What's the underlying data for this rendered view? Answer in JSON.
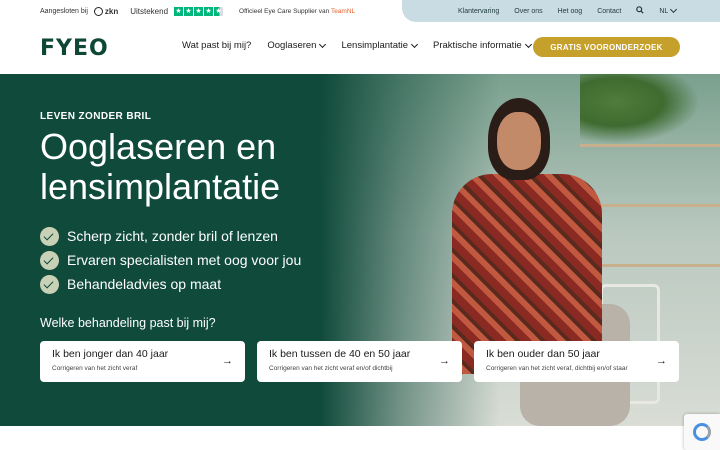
{
  "topbar": {
    "affiliated": "Aangesloten bij",
    "zkn": "zkn",
    "rating_word": "Uitstekend",
    "stars": 4.5,
    "supplier_text": "Officieel Eye Care Supplier van",
    "supplier_brand": "TeamNL"
  },
  "topnav": {
    "items": [
      "Klantervaring",
      "Over ons",
      "Het oog",
      "Contact"
    ],
    "search_icon": "search-icon",
    "language": "NL"
  },
  "header": {
    "logo": "FYEO",
    "nav": [
      "Wat past bij mij?",
      "Ooglaseren",
      "Lensimplantatie",
      "Praktische informatie"
    ],
    "cta": "GRATIS VOORONDERZOEK"
  },
  "hero": {
    "eyebrow": "LEVEN ZONDER BRIL",
    "headline": "Ooglaseren en lensimplantatie",
    "benefits": [
      "Scherp zicht, zonder bril of lenzen",
      "Ervaren specialisten met oog voor jou",
      "Behandeladvies op maat"
    ],
    "question": "Welke behandeling past bij mij?",
    "cards": [
      {
        "title": "Ik ben jonger dan 40 jaar",
        "subtitle": "Corrigeren van het zicht veraf"
      },
      {
        "title": "Ik ben tussen de 40 en 50 jaar",
        "subtitle": "Corrigeren van het zicht veraf en/of dichtbij"
      },
      {
        "title": "Ik ben ouder dan 50 jaar",
        "subtitle": "Corrigeren van het zicht veraf, dichtbij en/of staar"
      }
    ]
  },
  "colors": {
    "brand_green": "#0f4a3a",
    "cta_gold": "#c5a02a",
    "topnav_bg": "#c9dbe3",
    "trustpilot_green": "#00b67a"
  }
}
